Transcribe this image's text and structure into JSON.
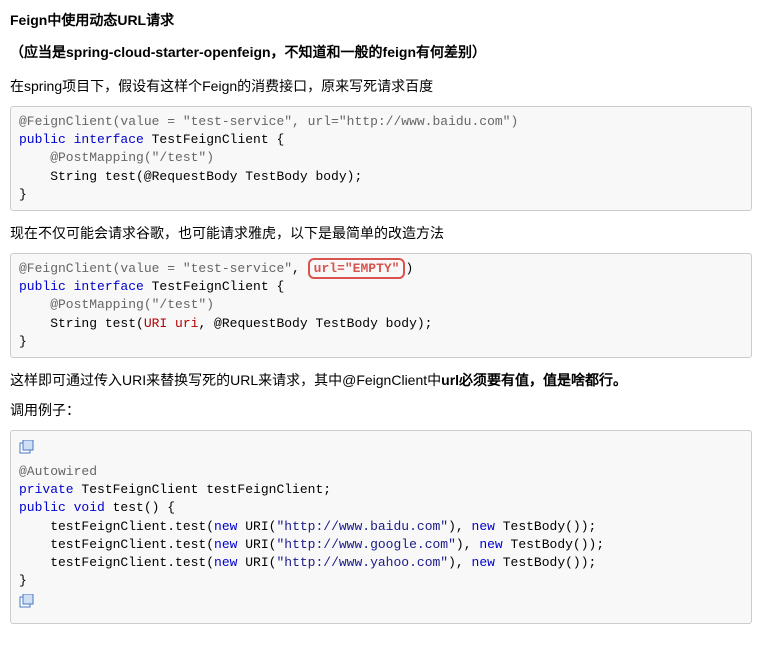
{
  "title": "Feign中使用动态URL请求",
  "subtitle": "（应当是spring-cloud-starter-openfeign，不知道和一般的feign有何差别）",
  "para1": "在spring项目下，假设有这样个Feign的消费接口，原来写死请求百度",
  "para2": "现在不仅可能会请求谷歌，也可能请求雅虎，以下是最简单的改造方法",
  "para3_pre": "这样即可通过传入URI来替换写死的URL来请求，其中@FeignClient中",
  "para3_bold": "url必须要有值，值是啥都行。",
  "para4": "调用例子：",
  "code1": {
    "l1a": "@FeignClient(value = ",
    "l1b": "\"test-service\"",
    "l1c": ", url=",
    "l1d": "\"http://www.baidu.com\"",
    "l1e": ")",
    "l2a": "public",
    "l2b": " interface",
    "l2c": " TestFeignClient {",
    "l3a": "    @PostMapping(",
    "l3b": "\"/test\"",
    "l3c": ")",
    "l4": "    String test(@RequestBody TestBody body);",
    "l5": "}"
  },
  "code2": {
    "l1a": "@FeignClient(value = ",
    "l1b": "\"test-service\"",
    "l1c": ", ",
    "l1_hl": "url=\"EMPTY\"",
    "l1d": ")",
    "l2a": "public",
    "l2b": " interface",
    "l2c": " TestFeignClient {",
    "l3a": "    @PostMapping(",
    "l3b": "\"/test\"",
    "l3c": ")",
    "l4a": "    String test(",
    "l4_uri": "URI uri",
    "l4b": ", @RequestBody TestBody body);",
    "l5": "}"
  },
  "code3": {
    "l1": "@Autowired",
    "l2a": "private",
    "l2b": " TestFeignClient testFeignClient;",
    "l3a": "public",
    "l3b": " void",
    "l3c": " test() {",
    "l4a": "    testFeignClient.test(",
    "l4_new": "new",
    "l4b": " URI(",
    "l4_str": "\"http://www.baidu.com\"",
    "l4c": "), ",
    "l4_new2": "new",
    "l4d": " TestBody());",
    "l5a": "    testFeignClient.test(",
    "l5_new": "new",
    "l5b": " URI(",
    "l5_str": "\"http://www.google.com\"",
    "l5c": "), ",
    "l5_new2": "new",
    "l5d": " TestBody());",
    "l6a": "    testFeignClient.test(",
    "l6_new": "new",
    "l6b": " URI(",
    "l6_str": "\"http://www.yahoo.com\"",
    "l6c": "), ",
    "l6_new2": "new",
    "l6d": " TestBody());",
    "l7": "}"
  }
}
